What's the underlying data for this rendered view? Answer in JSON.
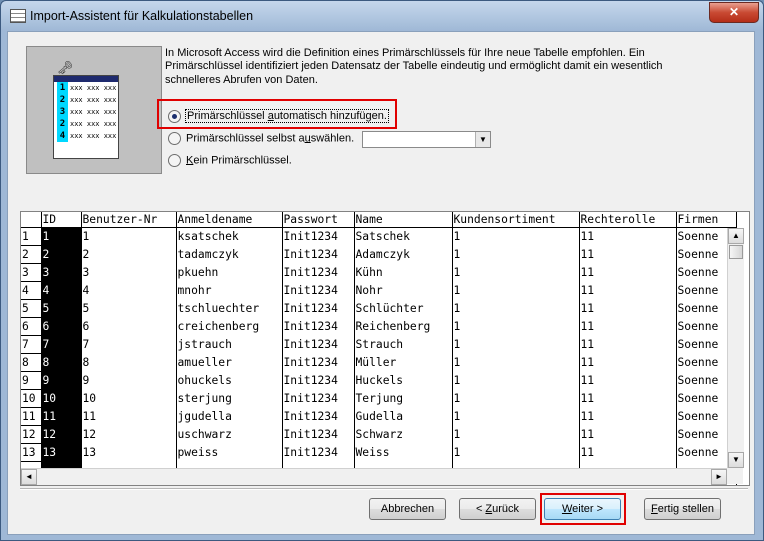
{
  "window": {
    "title": "Import-Assistent für Kalkulationstabellen",
    "close_label": "✕"
  },
  "illustration": {
    "rows": [
      {
        "num": "1",
        "cells": "xxx xxx xxx"
      },
      {
        "num": "2",
        "cells": "xxx xxx xxx"
      },
      {
        "num": "3",
        "cells": "xxx xxx xxx"
      },
      {
        "num": "2",
        "cells": "xxx xxx xxx"
      },
      {
        "num": "4",
        "cells": "xxx xxx xxx"
      }
    ]
  },
  "description": "In Microsoft Access wird die Definition eines Primärschlüssels für Ihre neue Tabelle empfohlen.  Ein Primärschlüssel identifiziert jeden Datensatz der Tabelle eindeutig und ermöglicht damit ein wesentlich schnelleres Abrufen von Daten.",
  "options": {
    "auto": {
      "pre": "Primärschlüssel ",
      "u": "a",
      "post": "utomatisch hinzufügen.",
      "selected": true
    },
    "own": {
      "pre": "Primärschlüssel selbst a",
      "u": "u",
      "post": "swählen.",
      "selected": false
    },
    "none": {
      "pre": "",
      "u": "K",
      "post": "ein Primärschlüssel.",
      "selected": false
    },
    "field_select_value": ""
  },
  "grid": {
    "columns": [
      "ID",
      "Benutzer-Nr",
      "Anmeldename",
      "Passwort",
      "Name",
      "Kundensortiment",
      "Rechterolle",
      "Firmen"
    ],
    "rows": [
      {
        "num": "1",
        "cells": [
          "1",
          "1",
          "ksatschek",
          "Init1234",
          "Satschek",
          "1",
          "11",
          "Soenne"
        ]
      },
      {
        "num": "2",
        "cells": [
          "2",
          "2",
          "tadamczyk",
          "Init1234",
          "Adamczyk",
          "1",
          "11",
          "Soenne"
        ]
      },
      {
        "num": "3",
        "cells": [
          "3",
          "3",
          "pkuehn",
          "Init1234",
          "Kühn",
          "1",
          "11",
          "Soenne"
        ]
      },
      {
        "num": "4",
        "cells": [
          "4",
          "4",
          "mnohr",
          "Init1234",
          "Nohr",
          "1",
          "11",
          "Soenne"
        ]
      },
      {
        "num": "5",
        "cells": [
          "5",
          "5",
          "tschluechter",
          "Init1234",
          "Schlüchter",
          "1",
          "11",
          "Soenne"
        ]
      },
      {
        "num": "6",
        "cells": [
          "6",
          "6",
          "creichenberg",
          "Init1234",
          "Reichenberg",
          "1",
          "11",
          "Soenne"
        ]
      },
      {
        "num": "7",
        "cells": [
          "7",
          "7",
          "jstrauch",
          "Init1234",
          "Strauch",
          "1",
          "11",
          "Soenne"
        ]
      },
      {
        "num": "8",
        "cells": [
          "8",
          "8",
          "amueller",
          "Init1234",
          "Müller",
          "1",
          "11",
          "Soenne"
        ]
      },
      {
        "num": "9",
        "cells": [
          "9",
          "9",
          "ohuckels",
          "Init1234",
          "Huckels",
          "1",
          "11",
          "Soenne"
        ]
      },
      {
        "num": "10",
        "cells": [
          "10",
          "10",
          "sterjung",
          "Init1234",
          "Terjung",
          "1",
          "11",
          "Soenne"
        ]
      },
      {
        "num": "11",
        "cells": [
          "11",
          "11",
          "jgudella",
          "Init1234",
          "Gudella",
          "1",
          "11",
          "Soenne"
        ]
      },
      {
        "num": "12",
        "cells": [
          "12",
          "12",
          "uschwarz",
          "Init1234",
          "Schwarz",
          "1",
          "11",
          "Soenne"
        ]
      },
      {
        "num": "13",
        "cells": [
          "13",
          "13",
          "pweiss",
          "Init1234",
          "Weiss",
          "1",
          "11",
          "Soenne"
        ]
      }
    ]
  },
  "buttons": {
    "cancel": {
      "pre": "Abbrechen",
      "u": "",
      "post": ""
    },
    "back": {
      "pre": "< ",
      "u": "Z",
      "post": "urück"
    },
    "next": {
      "pre": "",
      "u": "W",
      "post": "eiter >"
    },
    "finish": {
      "pre": "",
      "u": "F",
      "post": "ertig stellen"
    }
  },
  "colors": {
    "highlight": "#e00000",
    "accent": "#3c7fb1"
  }
}
